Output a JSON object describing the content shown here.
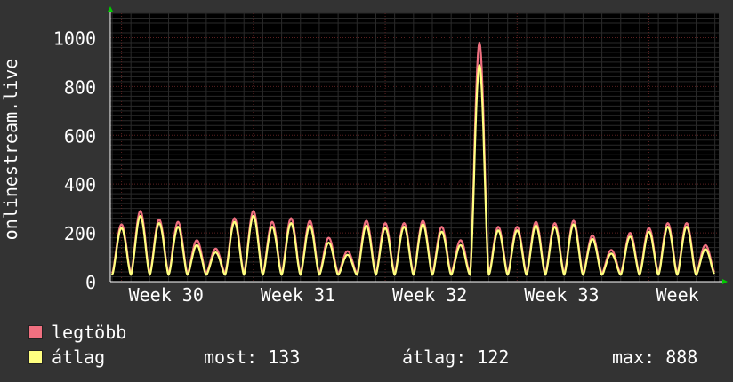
{
  "chart_data": {
    "type": "line",
    "ylabel": "onlinestream.live",
    "yticks": [
      0,
      200,
      400,
      600,
      800,
      1000
    ],
    "ylim": [
      0,
      1100
    ],
    "xticks": [
      "Week 30",
      "Week 31",
      "Week 32",
      "Week 33",
      "Week"
    ],
    "grid": true,
    "series": [
      {
        "name": "legtöbb",
        "color": "#f07080",
        "values": [
          235,
          290,
          255,
          245,
          170,
          135,
          260,
          290,
          245,
          260,
          250,
          180,
          125,
          250,
          240,
          240,
          250,
          225,
          170,
          980,
          225,
          225,
          245,
          240,
          250,
          190,
          130,
          200,
          220,
          240,
          240,
          150
        ]
      },
      {
        "name": "átlag",
        "color": "#ffff80",
        "values": [
          220,
          270,
          240,
          225,
          150,
          120,
          245,
          270,
          225,
          240,
          230,
          160,
          110,
          230,
          220,
          225,
          235,
          205,
          150,
          888,
          210,
          210,
          230,
          225,
          235,
          175,
          115,
          185,
          205,
          225,
          225,
          133
        ]
      }
    ]
  },
  "legend": {
    "max_label": "legtöbb",
    "avg_label": "átlag",
    "stats": {
      "now": "most: 133",
      "avg": "átlag: 122",
      "max": "max: 888"
    }
  }
}
